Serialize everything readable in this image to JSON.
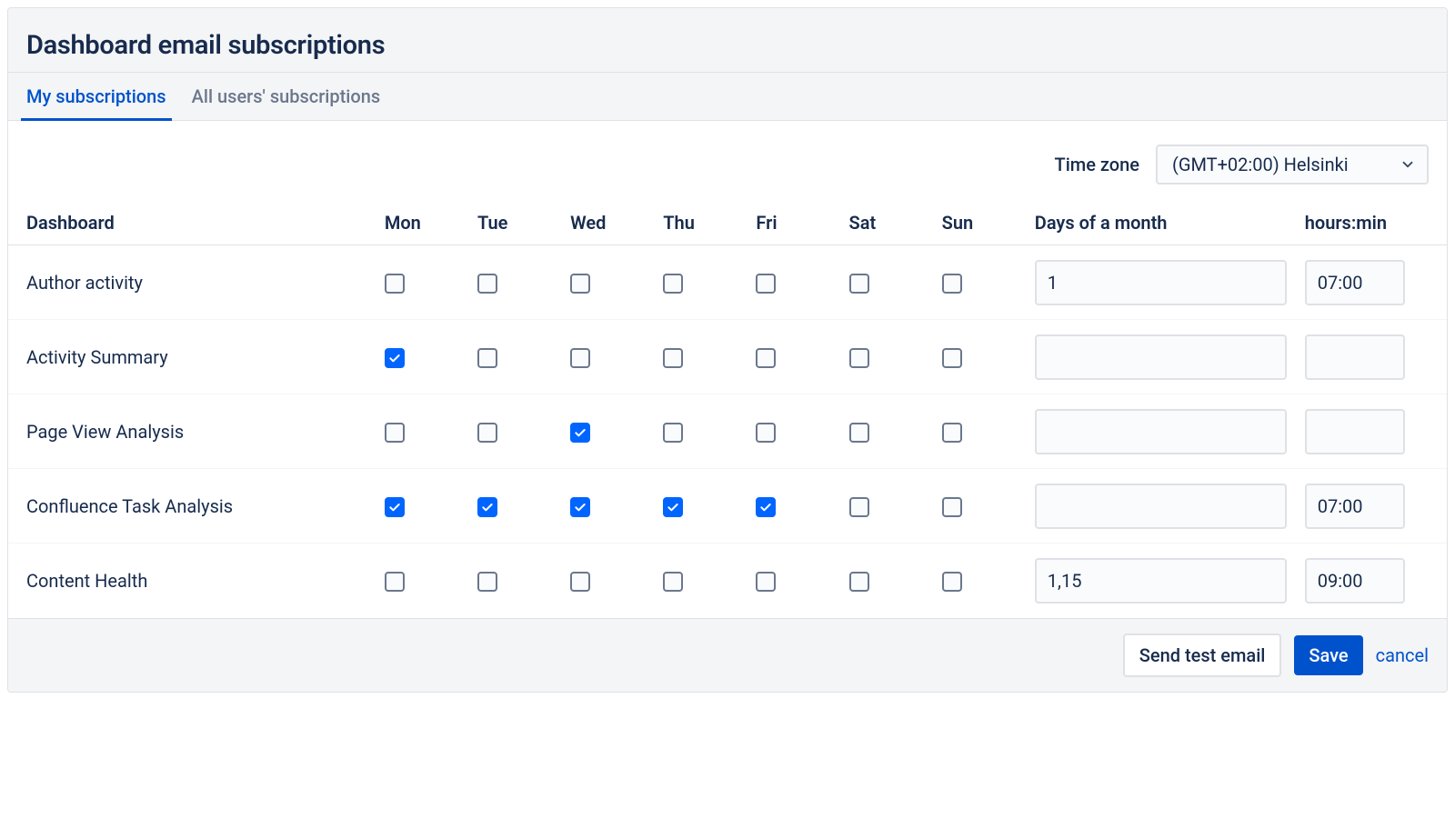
{
  "header": {
    "title": "Dashboard email subscriptions"
  },
  "tabs": [
    {
      "id": "my",
      "label": "My subscriptions",
      "active": true
    },
    {
      "id": "all",
      "label": "All users' subscriptions",
      "active": false
    }
  ],
  "timezone": {
    "label": "Time zone",
    "value": "(GMT+02:00) Helsinki"
  },
  "columns": {
    "name": "Dashboard",
    "days": [
      "Mon",
      "Tue",
      "Wed",
      "Thu",
      "Fri",
      "Sat",
      "Sun"
    ],
    "days_of_month": "Days of a month",
    "hours": "hours:min"
  },
  "rows": [
    {
      "name": "Author activity",
      "checks": [
        false,
        false,
        false,
        false,
        false,
        false,
        false
      ],
      "days_of_month": "1",
      "hours": "07:00"
    },
    {
      "name": "Activity Summary",
      "checks": [
        true,
        false,
        false,
        false,
        false,
        false,
        false
      ],
      "days_of_month": "",
      "hours": ""
    },
    {
      "name": "Page View Analysis",
      "checks": [
        false,
        false,
        true,
        false,
        false,
        false,
        false
      ],
      "days_of_month": "",
      "hours": ""
    },
    {
      "name": "Confluence Task Analysis",
      "checks": [
        true,
        true,
        true,
        true,
        true,
        false,
        false
      ],
      "days_of_month": "",
      "hours": "07:00"
    },
    {
      "name": "Content Health",
      "checks": [
        false,
        false,
        false,
        false,
        false,
        false,
        false
      ],
      "days_of_month": "1,15",
      "hours": "09:00"
    }
  ],
  "footer": {
    "send_test": "Send test email",
    "save": "Save",
    "cancel": "cancel"
  }
}
